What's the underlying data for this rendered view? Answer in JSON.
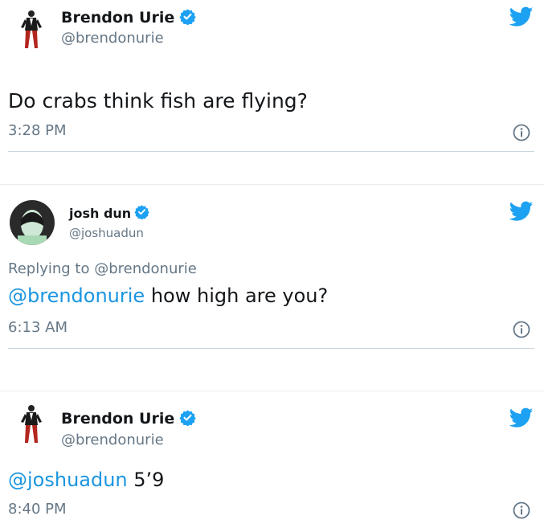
{
  "tweets": [
    {
      "display_name": "Brendon Urie",
      "handle": "@brendonurie",
      "text": "Do crabs think fish are flying?",
      "time": "3:28 PM",
      "verified": true,
      "icons": [
        "avatar-brendon",
        "verified-icon",
        "twitter-bird-icon",
        "info-icon"
      ]
    },
    {
      "display_name": "josh dun",
      "handle": "@joshuadun",
      "replying_to": "Replying to @brendonurie",
      "mention": "@brendonurie",
      "text": "how high are you?",
      "time": "6:13 AM",
      "verified": true,
      "icons": [
        "avatar-josh",
        "verified-icon",
        "twitter-bird-icon",
        "info-icon"
      ]
    },
    {
      "display_name": "Brendon Urie",
      "handle": "@brendonurie",
      "mention": "@joshuadun",
      "text": "5’9",
      "time": "8:40 PM",
      "verified": true,
      "icons": [
        "avatar-brendon",
        "verified-icon",
        "twitter-bird-icon",
        "info-icon"
      ]
    }
  ],
  "colors": {
    "twitter_blue": "#1da1f2",
    "mention_blue": "#1b95e0",
    "secondary_text": "#657786",
    "primary_text": "#14171a"
  }
}
